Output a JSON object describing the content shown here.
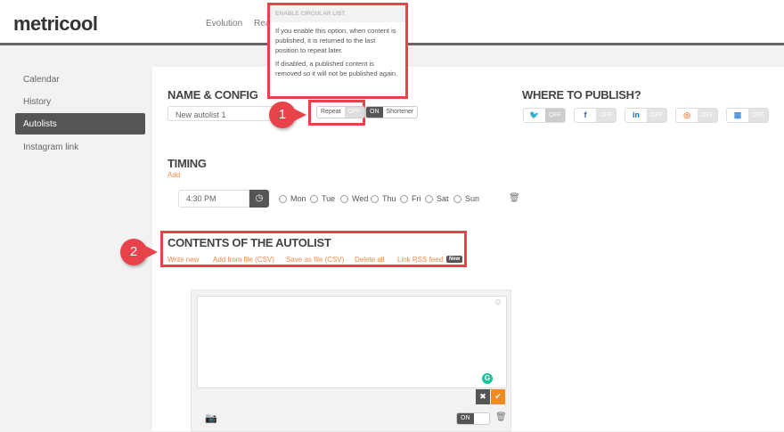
{
  "header": {
    "logo": "metricool",
    "nav": [
      "Evolution",
      "Real"
    ]
  },
  "sidebar": {
    "items": [
      {
        "label": "Calendar"
      },
      {
        "label": "History"
      },
      {
        "label": "Autolists",
        "active": true
      },
      {
        "label": "Instagram link"
      }
    ]
  },
  "tooltip": {
    "title": "ENABLE CIRCULAR LIST",
    "p1": "If you enable this option, when content is published, it is returned to the last position to repeat later.",
    "p2": "If disabled, a published content is removed so it will not be published again."
  },
  "config": {
    "title": "NAME & CONFIG",
    "name_value": "New autolist 1",
    "repeat_label": "Repeat",
    "repeat_state": "OFF",
    "shortener_state": "ON",
    "shortener_label": "Shortener"
  },
  "publish": {
    "title": "WHERE TO PUBLISH?",
    "networks": [
      {
        "icon": "twitter-icon",
        "glyph": "🐦",
        "state": "OFF",
        "color": "#1da1f2"
      },
      {
        "icon": "facebook-icon",
        "glyph": "f",
        "state": "OFF",
        "color": "#3b5998"
      },
      {
        "icon": "linkedin-icon",
        "glyph": "in",
        "state": "OFF",
        "color": "#0077b5"
      },
      {
        "icon": "instagram-icon",
        "glyph": "◎",
        "state": "OFF",
        "color": "#f08a4b"
      },
      {
        "icon": "gmb-icon",
        "glyph": "▦",
        "state": "OFF",
        "color": "#4a90d9"
      }
    ]
  },
  "timing": {
    "title": "TIMING",
    "add": "Add",
    "time": "4:30 PM",
    "days": [
      "Mon",
      "Tue",
      "Wed",
      "Thu",
      "Fri",
      "Sat",
      "Sun"
    ]
  },
  "contents": {
    "title": "CONTENTS OF THE AUTOLIST",
    "links": [
      "Write new",
      "Add from file (CSV)",
      "Save as file (CSV)",
      "Delete all",
      "Link RSS feed"
    ],
    "new_badge": "New",
    "toggle": "ON"
  },
  "callouts": [
    "1",
    "2"
  ]
}
